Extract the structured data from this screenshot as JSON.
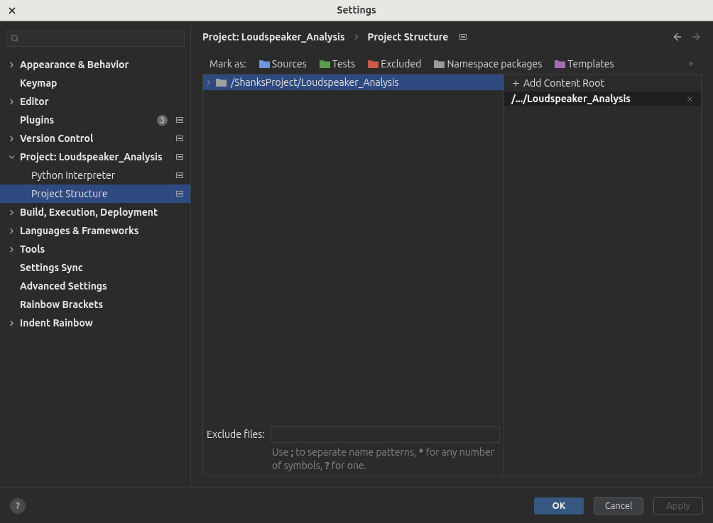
{
  "window": {
    "title": "Settings"
  },
  "sidebar": {
    "items": [
      {
        "label": "Appearance & Behavior",
        "expanded": false,
        "selected": false,
        "project_level": false
      },
      {
        "label": "Keymap",
        "selected": false,
        "project_level": false
      },
      {
        "label": "Editor",
        "expanded": false,
        "selected": false,
        "project_level": false
      },
      {
        "label": "Plugins",
        "selected": false,
        "project_level": true,
        "badge": "3"
      },
      {
        "label": "Version Control",
        "expanded": false,
        "selected": false,
        "project_level": true
      },
      {
        "label": "Project: Loudspeaker_Analysis",
        "expanded": true,
        "selected": false,
        "project_level": true,
        "children": [
          {
            "label": "Python Interpreter",
            "selected": false,
            "project_level": true
          },
          {
            "label": "Project Structure",
            "selected": true,
            "project_level": true
          }
        ]
      },
      {
        "label": "Build, Execution, Deployment",
        "expanded": false,
        "selected": false,
        "project_level": false
      },
      {
        "label": "Languages & Frameworks",
        "expanded": false,
        "selected": false,
        "project_level": false
      },
      {
        "label": "Tools",
        "expanded": false,
        "selected": false,
        "project_level": false
      },
      {
        "label": "Settings Sync",
        "selected": false,
        "project_level": false
      },
      {
        "label": "Advanced Settings",
        "selected": false,
        "project_level": false
      },
      {
        "label": "Rainbow Brackets",
        "selected": false,
        "project_level": false
      },
      {
        "label": "Indent Rainbow",
        "expanded": false,
        "selected": false,
        "project_level": false
      }
    ]
  },
  "breadcrumb": [
    "Project: Loudspeaker_Analysis",
    "Project Structure"
  ],
  "mark_as": {
    "label": "Mark as:",
    "options": [
      {
        "label": "Sources",
        "color": "#6f95d8"
      },
      {
        "label": "Tests",
        "color": "#5e9b52"
      },
      {
        "label": "Excluded",
        "color": "#cc5a4c"
      },
      {
        "label": "Namespace packages",
        "color": "#9a9a9a"
      },
      {
        "label": "Templates",
        "color": "#a66bb0"
      }
    ]
  },
  "tree": [
    {
      "label": "/ShanksProject/Loudspeaker_Analysis",
      "selected": true
    }
  ],
  "exclude_files": {
    "label": "Exclude files:",
    "hint": "Use **;** to separate name patterns, ***** for any number of symbols, **?** for one."
  },
  "content_roots": {
    "add": "Add Content Root",
    "roots": [
      {
        "label": "/.../Loudspeaker_Analysis",
        "selected": true
      }
    ]
  },
  "footer": {
    "help": "?",
    "buttons": [
      {
        "label": "OK",
        "kind": "primary",
        "disabled": false
      },
      {
        "label": "Cancel",
        "kind": "normal",
        "disabled": false
      },
      {
        "label": "Apply",
        "kind": "normal",
        "disabled": true
      }
    ]
  }
}
